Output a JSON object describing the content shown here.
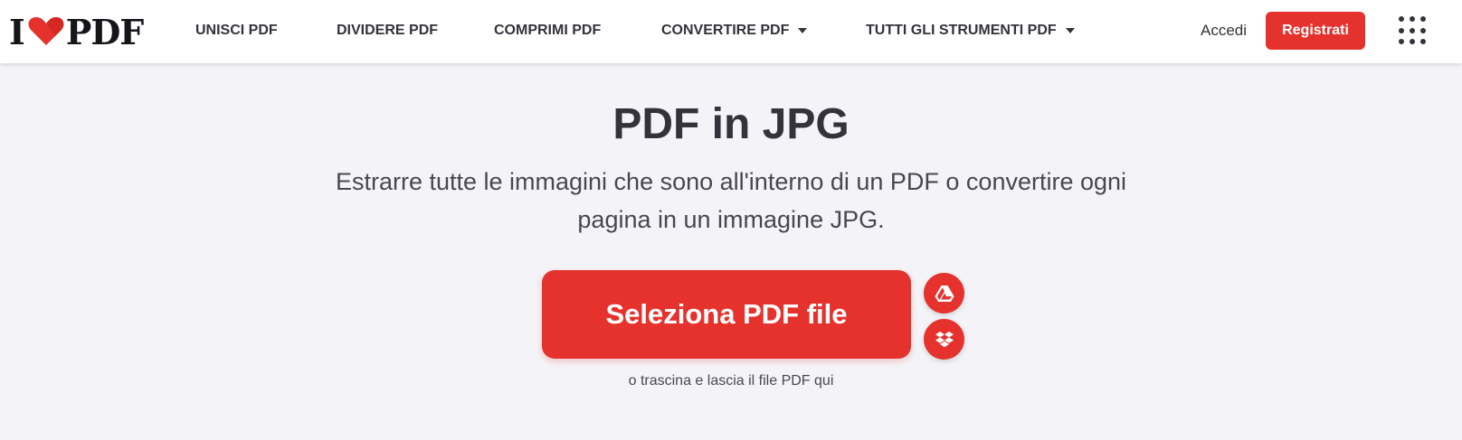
{
  "brand": {
    "logo_left": "I",
    "logo_right": "PDF",
    "accent": "#e5322d",
    "text_dark": "#33333b",
    "background": "#f4f4f8"
  },
  "nav": {
    "items": [
      {
        "label": "UNISCI PDF"
      },
      {
        "label": "DIVIDERE PDF"
      },
      {
        "label": "COMPRIMI PDF"
      },
      {
        "label": "CONVERTIRE PDF",
        "dropdown": true
      },
      {
        "label": "TUTTI GLI STRUMENTI PDF",
        "dropdown": true
      }
    ],
    "login_label": "Accedi",
    "register_label": "Registrati",
    "apps_icon": "grid-icon"
  },
  "main": {
    "title": "PDF in JPG",
    "subtitle_line1": "Estrarre tutte le immagini che sono all'interno di un PDF o convertire ogni",
    "subtitle_line2": "pagina in un immagine JPG.",
    "select_button_label": "Seleziona PDF file",
    "cloud_buttons": [
      {
        "icon": "google-drive-icon"
      },
      {
        "icon": "dropbox-icon"
      }
    ],
    "drop_hint": "o trascina e lascia il file PDF qui"
  }
}
